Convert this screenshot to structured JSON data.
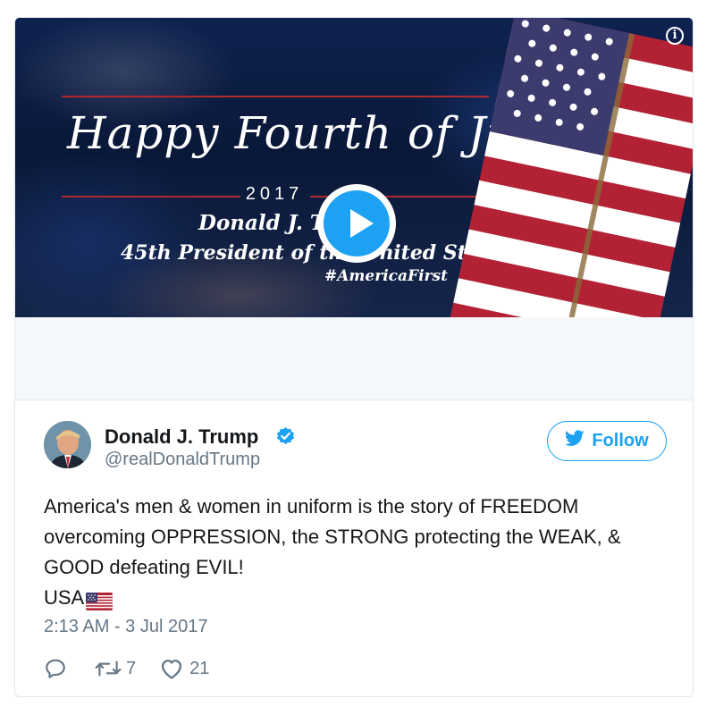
{
  "media": {
    "title": "Happy Fourth of July",
    "year": "2017",
    "signature_name": "Donald J. Trump",
    "signature_title": "45th President of the United States",
    "hashtag": "#AmericaFirst",
    "info_glyph": "i",
    "play_icon": "play-icon",
    "accent_blue": "#1da1f2"
  },
  "author": {
    "name": "Donald J. Trump",
    "handle": "@realDonaldTrump",
    "verified_icon": "verified-badge-icon"
  },
  "follow_button": {
    "label": "Follow",
    "icon": "twitter-bird-icon"
  },
  "tweet": {
    "text_lines": [
      "America's men & women in uniform is the story of FREEDOM",
      "overcoming OPPRESSION, the STRONG protecting the WEAK, &",
      "GOOD defeating EVIL!"
    ],
    "usa_text": "USA",
    "emoji": "us-flag-emoji"
  },
  "timestamp": "2:13 AM - 3 Jul 2017",
  "actions": {
    "reply_icon": "reply-icon",
    "retweet_icon": "retweet-icon",
    "retweet_count": "7",
    "like_icon": "heart-icon",
    "like_count": "21"
  },
  "colors": {
    "text_primary": "#14171a",
    "text_secondary": "#657786",
    "border": "#e1e8ed",
    "flag_red": "#b22234",
    "flag_blue": "#3c3b6e"
  }
}
